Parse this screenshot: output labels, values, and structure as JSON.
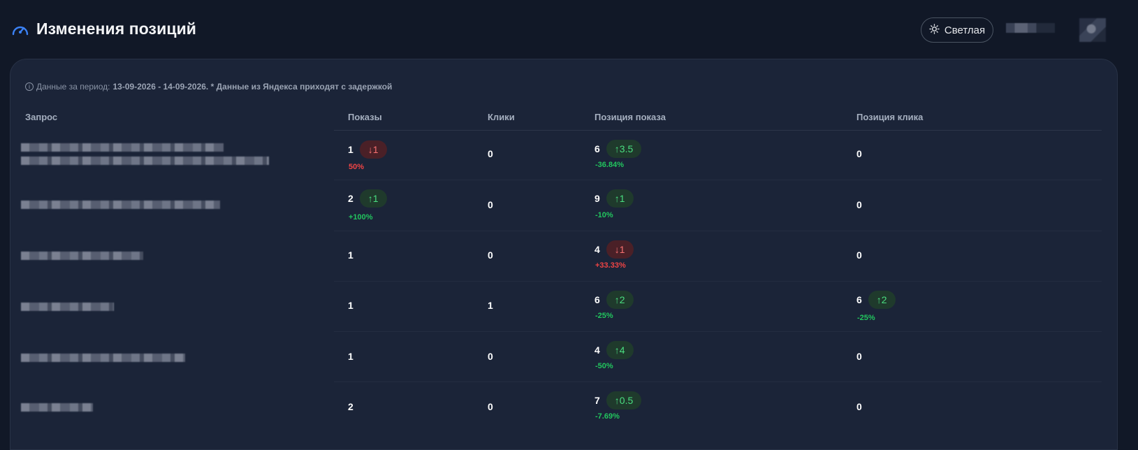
{
  "header": {
    "title": "Изменения позиций",
    "theme_button": "Светлая"
  },
  "note": {
    "prefix": "Данные за период:",
    "period": "13-09-2026 - 14-09-2026. * Данные из Яндекса приходят с задержкой"
  },
  "table": {
    "columns": [
      "Запрос",
      "Показы",
      "Клики",
      "Позиция показа",
      "Позиция клика"
    ],
    "rows": [
      {
        "impressions": "1",
        "impressions_badge": "↓1",
        "impressions_delta": "50%",
        "clicks": "0",
        "impression_position": "6",
        "impression_position_badge": "↑3.5",
        "impression_position_delta": "-36.84%",
        "click_position": "0"
      },
      {
        "impressions": "2",
        "impressions_badge": "↑1",
        "impressions_delta": "+100%",
        "clicks": "0",
        "impression_position": "9",
        "impression_position_badge": "↑1",
        "impression_position_delta": "-10%",
        "click_position": "0"
      },
      {
        "impressions": "1",
        "clicks": "0",
        "impression_position": "4",
        "impression_position_badge": "↓1",
        "impression_position_delta": "+33.33%",
        "click_position": "0"
      },
      {
        "impressions": "1",
        "clicks": "1",
        "impression_position": "6",
        "impression_position_badge": "↑2",
        "impression_position_delta": "-25%",
        "click_position": "6",
        "click_position_badge": "↑2",
        "click_position_delta": "-25%"
      },
      {
        "impressions": "1",
        "clicks": "0",
        "impression_position": "4",
        "impression_position_badge": "↑4",
        "impression_position_delta": "-50%",
        "click_position": "0"
      },
      {
        "impressions": "2",
        "clicks": "0",
        "impression_position": "7",
        "impression_position_badge": "↑0.5",
        "impression_position_delta": "-7.69%",
        "click_position": "0"
      }
    ]
  },
  "colors": {
    "background": "#111827",
    "card": "#1b2438",
    "up": "#4ade80",
    "down": "#f87171"
  }
}
